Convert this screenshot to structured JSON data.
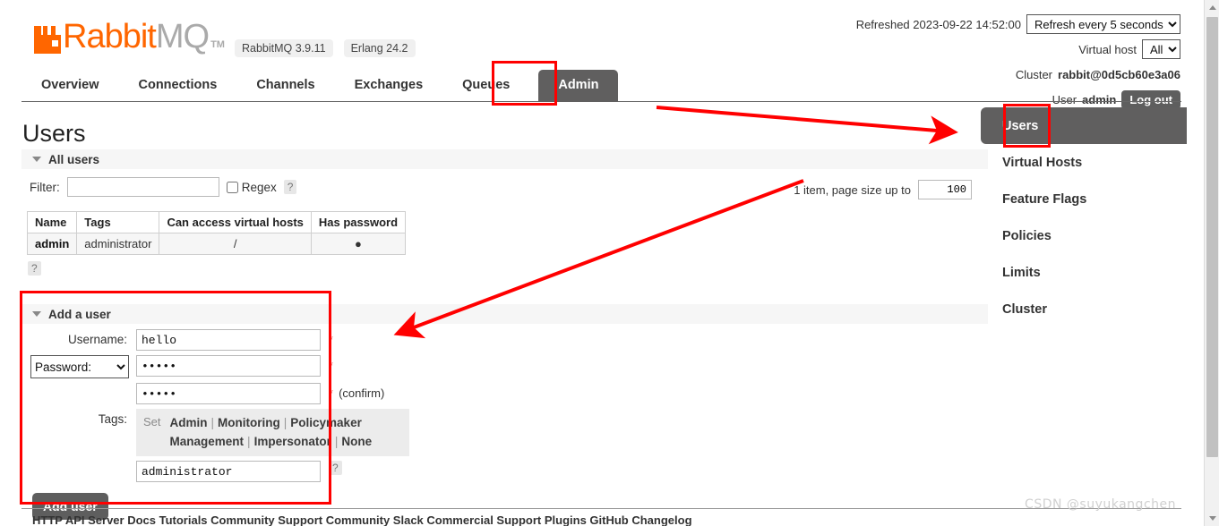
{
  "header": {
    "logo_rabbit": "Rabbit",
    "logo_mq": "MQ",
    "logo_tm": "TM",
    "badges": [
      "RabbitMQ 3.9.11",
      "Erlang 24.2"
    ],
    "refreshed_label": "Refreshed 2023-09-22 14:52:00",
    "refresh_select_value": "Refresh every 5 seconds",
    "refresh_options": [
      "Refresh every 5 seconds"
    ],
    "vhost_label": "Virtual host",
    "vhost_value": "All",
    "vhost_options": [
      "All"
    ],
    "cluster_label": "Cluster",
    "cluster_value": "rabbit@0d5cb60e3a06",
    "user_label": "User",
    "user_value": "admin",
    "logout_label": "Log out"
  },
  "nav": {
    "items": [
      {
        "label": "Overview",
        "active": false
      },
      {
        "label": "Connections",
        "active": false
      },
      {
        "label": "Channels",
        "active": false
      },
      {
        "label": "Exchanges",
        "active": false
      },
      {
        "label": "Queues",
        "active": false
      },
      {
        "label": "Admin",
        "active": true
      }
    ]
  },
  "main": {
    "page_title": "Users",
    "all_users_section": "All users",
    "filter_label": "Filter:",
    "filter_value": "",
    "filter_placeholder": "",
    "regex_label": "Regex",
    "help_mark": "?",
    "pagesize_text": "1 item, page size up to",
    "pagesize_value": "100",
    "table": {
      "columns": [
        "Name",
        "Tags",
        "Can access virtual hosts",
        "Has password"
      ],
      "rows": [
        {
          "name": "admin",
          "tags": "administrator",
          "vhosts": "/",
          "has_password": "●"
        }
      ]
    },
    "table_help_mark": "?"
  },
  "add_user": {
    "section_title": "Add a user",
    "username_label": "Username:",
    "username_value": "hello",
    "password_select_value": "Password:",
    "password_options": [
      "Password:"
    ],
    "password_value": "hello",
    "password_confirm_value": "hello",
    "required_mark": "*",
    "confirm_label": "(confirm)",
    "tags_label": "Tags:",
    "tags_value": "administrator",
    "presets_set_label": "Set",
    "preset_links_row1": [
      "Admin",
      "Monitoring",
      "Policymaker"
    ],
    "preset_links_row2": [
      "Management",
      "Impersonator",
      "None"
    ],
    "preset_separator": "|",
    "presets_help_mark": "?",
    "submit_label": "Add user"
  },
  "sidebar": {
    "items": [
      {
        "label": "Users",
        "active": true
      },
      {
        "label": "Virtual Hosts",
        "active": false
      },
      {
        "label": "Feature Flags",
        "active": false
      },
      {
        "label": "Policies",
        "active": false
      },
      {
        "label": "Limits",
        "active": false
      },
      {
        "label": "Cluster",
        "active": false
      }
    ]
  },
  "footer": {
    "text": "HTTP API   Server Docs   Tutorials   Community Support   Community Slack   Commercial Support   Plugins   GitHub   Changelog",
    "watermark": "CSDN @suyukangchen"
  },
  "scrollbar": {
    "up_arrow": "▲",
    "down_arrow": "▼"
  },
  "colors": {
    "brand_orange": "#ff6600",
    "active_gray": "#605f5f",
    "annotation_red": "#ff0000",
    "section_bg": "#f6f6f6"
  }
}
